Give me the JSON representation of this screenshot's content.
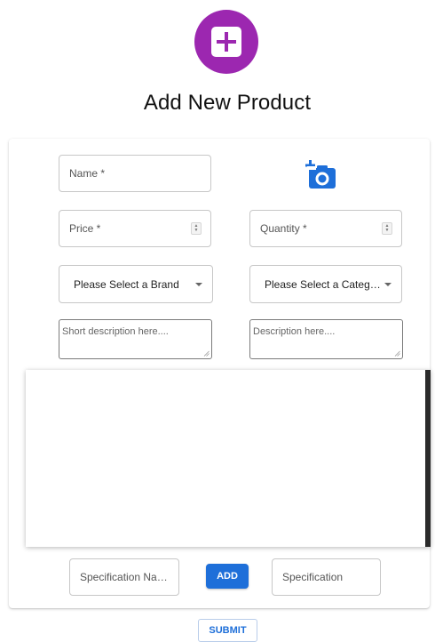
{
  "header": {
    "logo_icon": "add-box-icon",
    "logo_color": "#9c27b0",
    "title": "Add New Product"
  },
  "form": {
    "name_placeholder": "Name *",
    "camera_icon": "add-a-photo-icon",
    "camera_color": "#1e6fd9",
    "price_placeholder": "Price *",
    "quantity_placeholder": "Quantity *",
    "brand_select": "Please Select a Brand",
    "category_select": "Please Select a Categ…",
    "short_description_placeholder": "Short description here....",
    "description_placeholder": "Description here....",
    "specification_name_placeholder": "Specification Na…",
    "add_label": "ADD",
    "specification_placeholder": "Specification"
  },
  "actions": {
    "submit_label": "SUBMIT",
    "accent": "#1e6fd9"
  }
}
